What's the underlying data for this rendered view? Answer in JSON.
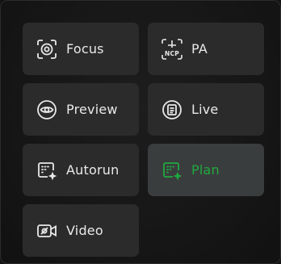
{
  "buttons": {
    "focus": {
      "label": "Focus",
      "icon": "focus-icon"
    },
    "pa": {
      "label": "PA",
      "icon": "ncp-crosshair-icon",
      "icon_text": "NCP"
    },
    "preview": {
      "label": "Preview",
      "icon": "eye-icon"
    },
    "live": {
      "label": "Live",
      "icon": "live-document-icon"
    },
    "autorun": {
      "label": "Autorun",
      "icon": "autorun-icon"
    },
    "plan": {
      "label": "Plan",
      "icon": "plan-icon",
      "active": true
    },
    "video": {
      "label": "Video",
      "icon": "video-camera-icon"
    }
  },
  "colors": {
    "button_bg": "#2b2b2b",
    "active_bg": "#3a3d3d",
    "active_text": "#1faa3f",
    "text": "#e9e9e9"
  }
}
